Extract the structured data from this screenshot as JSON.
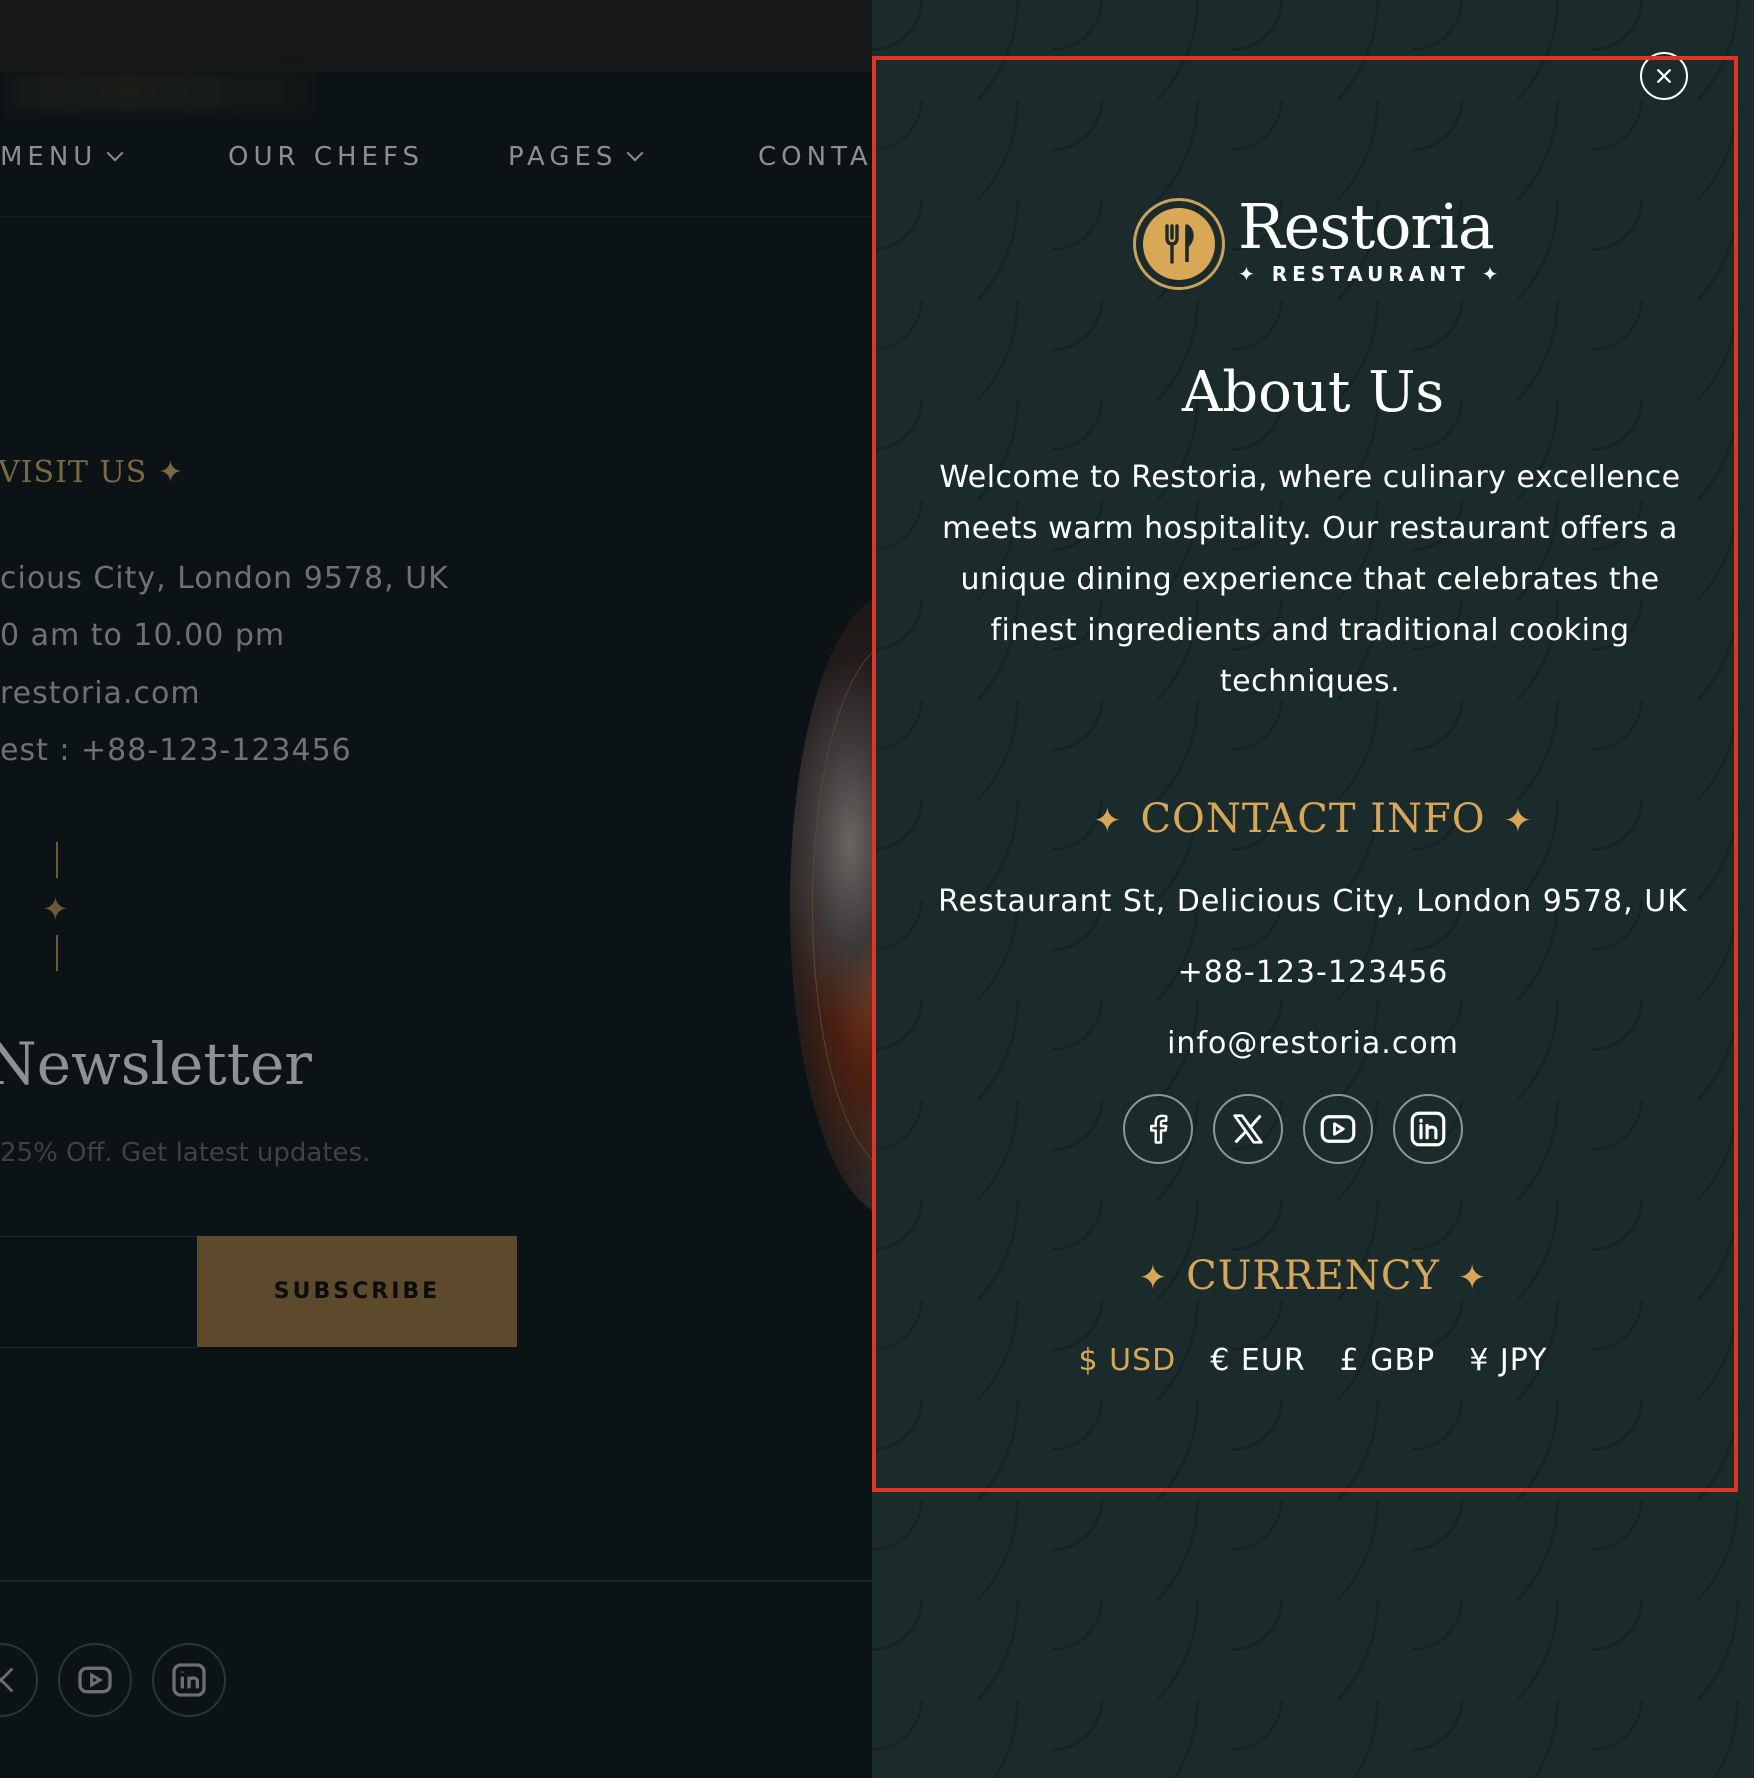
{
  "background_page": {
    "nav": [
      {
        "label": "MENU",
        "has_dropdown": true
      },
      {
        "label": "OUR CHEFS",
        "has_dropdown": false
      },
      {
        "label": "PAGES",
        "has_dropdown": true
      },
      {
        "label": "CONTA",
        "has_dropdown": false
      }
    ],
    "visit": {
      "title": "VISIT US ✦",
      "lines": [
        "cious City, London 9578, UK",
        "0 am to 10.00 pm",
        "restoria.com",
        "est : +88-123-123456"
      ]
    },
    "newsletter": {
      "title": "Newsletter",
      "subtitle": "25% Off. Get latest updates.",
      "subscribe_label": "SUBSCRIBE"
    },
    "social_icons": [
      "x-icon",
      "youtube-icon",
      "linkedin-icon"
    ]
  },
  "panel": {
    "brand": {
      "name": "Restoria",
      "subtitle": "✦ RESTAURANT ✦"
    },
    "about": {
      "title": "About Us",
      "text": "Welcome to Restoria, where culinary excellence meets warm hospitality. Our restaurant offers a unique dining experience that celebrates the finest ingredients and traditional cooking techniques."
    },
    "contact": {
      "title": "CONTACT INFO",
      "address": "Restaurant St, Delicious City, London 9578, UK",
      "phone": "+88-123-123456",
      "email": "info@restoria.com"
    },
    "social": [
      "facebook-icon",
      "x-icon",
      "youtube-icon",
      "linkedin-icon"
    ],
    "currency": {
      "title": "CURRENCY",
      "options": [
        "$ USD",
        "€ EUR",
        "£ GBP",
        "¥ JPY"
      ],
      "selected": "$ USD"
    }
  },
  "colors": {
    "accent_gold": "#d6a758",
    "panel_bg": "#1b2a2a",
    "highlight_red": "#e03426"
  }
}
